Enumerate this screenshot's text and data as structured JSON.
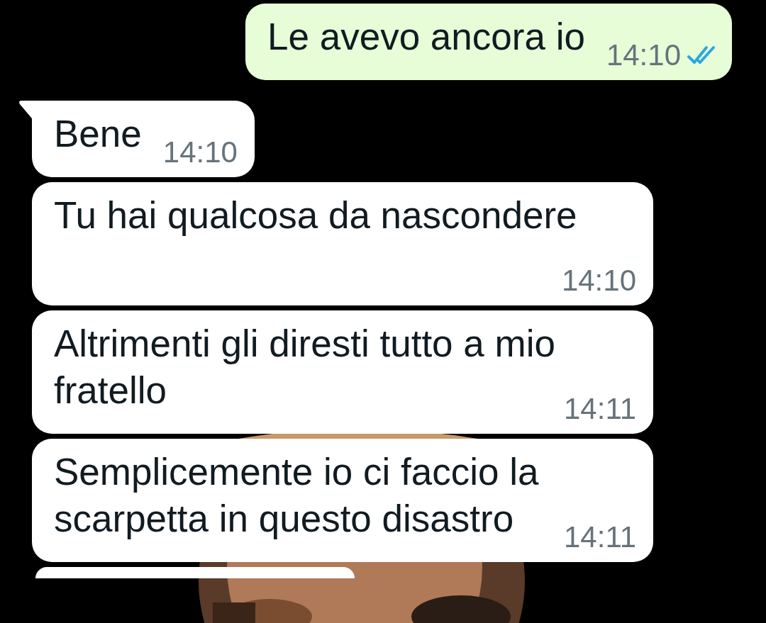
{
  "messages": [
    {
      "kind": "outgoing",
      "text": "Le avevo ancora io",
      "time": "14:10",
      "read": true,
      "tail": false
    },
    {
      "kind": "incoming",
      "text": "Bene",
      "time": "14:10",
      "tail": true
    },
    {
      "kind": "incoming",
      "text": "Tu hai qualcosa da nascondere",
      "time": "14:10",
      "tail": false
    },
    {
      "kind": "incoming",
      "text": "Altrimenti gli diresti tutto a mio fratello",
      "time": "14:11",
      "tail": false
    },
    {
      "kind": "incoming",
      "text": "Semplicemente io ci faccio la scarpetta in questo disastro",
      "time": "14:11",
      "tail": false
    },
    {
      "kind": "incoming",
      "tail": false
    }
  ]
}
